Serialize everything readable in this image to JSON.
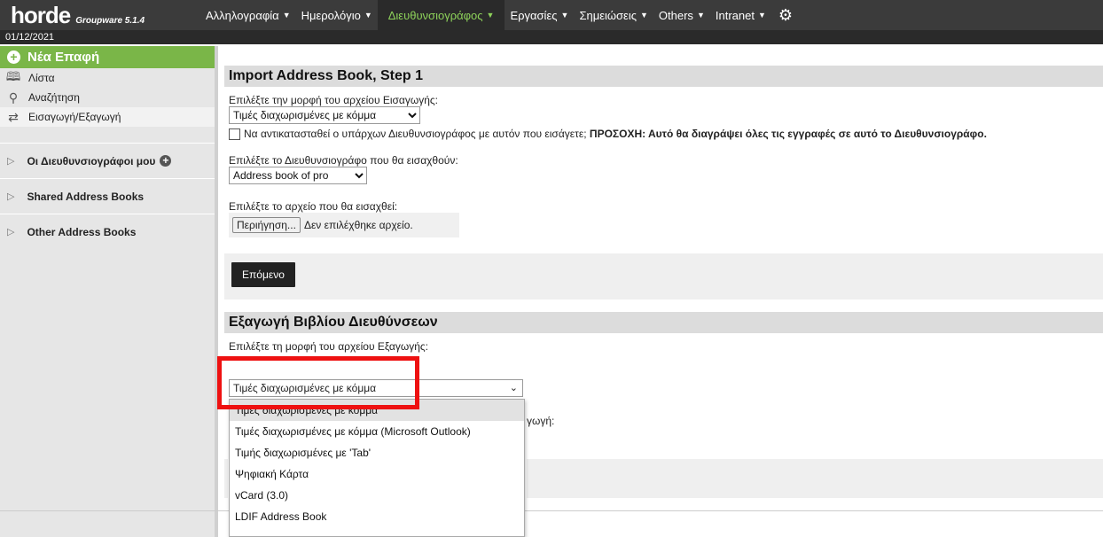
{
  "header": {
    "logo": "horde",
    "product": "Groupware 5.1.4",
    "menu": [
      {
        "label": "Αλληλογραφία",
        "active": false
      },
      {
        "label": "Ημερολόγιο",
        "active": false
      },
      {
        "label": "Διευθυνσιογράφος",
        "active": true
      },
      {
        "label": "Εργασίες",
        "active": false
      },
      {
        "label": "Σημειώσεις",
        "active": false
      },
      {
        "label": "Others",
        "active": false
      },
      {
        "label": "Intranet",
        "active": false
      }
    ],
    "date": "01/12/2021"
  },
  "sidebar": {
    "new_contact": "Νέα Επαφή",
    "items": [
      {
        "label": "Λίστα",
        "icon": "book-icon"
      },
      {
        "label": "Αναζήτηση",
        "icon": "search-icon"
      },
      {
        "label": "Εισαγωγή/Εξαγωγή",
        "icon": "import-export-icon"
      }
    ],
    "sections": [
      {
        "label": "Οι Διευθυνσιογράφοι μου"
      },
      {
        "label": "Shared Address Books"
      },
      {
        "label": "Other Address Books"
      }
    ]
  },
  "import": {
    "title": "Import Address Book, Step 1",
    "format_label": "Επιλέξτε την μορφή του αρχείου Εισαγωγής:",
    "format_value": "Τιμές διαχωρισμένες με κόμμα",
    "replace_label": "Να αντικατασταθεί ο υπάρχων Διευθυνσιογράφος με αυτόν που εισάγετε;",
    "replace_warning": "ΠΡΟΣΟΧΗ: Αυτό θα διαγράψει όλες τις εγγραφές σε αυτό το Διευθυνσιογράφο.",
    "book_label": "Επιλέξτε το Διευθυνσιογράφο που θα εισαχθούν:",
    "book_value": "Address book of pro",
    "file_label": "Επιλέξτε το αρχείο που θα εισαχθεί:",
    "browse_button": "Περιήγηση...",
    "no_file": "Δεν επιλέχθηκε αρχείο.",
    "next_button": "Επόμενο"
  },
  "export": {
    "title": "Εξαγωγή Βιβλίου Διευθύνσεων",
    "format_label": "Επιλέξτε τη μορφή του αρχείου Εξαγωγής:",
    "format_value": "Τιμές διαχωρισμένες με κόμμα",
    "hidden_label_tail": "γωγή:",
    "options": [
      "Τιμές διαχωρισμένες με κόμμα",
      "Τιμές διαχωρισμένες με κόμμα (Microsoft Outlook)",
      "Τιμής διαχωρισμένες με 'Tab'",
      "Ψηφιακή Κάρτα",
      "vCard (3.0)",
      "LDIF Address Book"
    ]
  },
  "colors": {
    "topbar": "#3b3b3b",
    "active_menu": "#8dd15a",
    "new_contact": "#7ab648",
    "highlight": "#ee1111"
  }
}
